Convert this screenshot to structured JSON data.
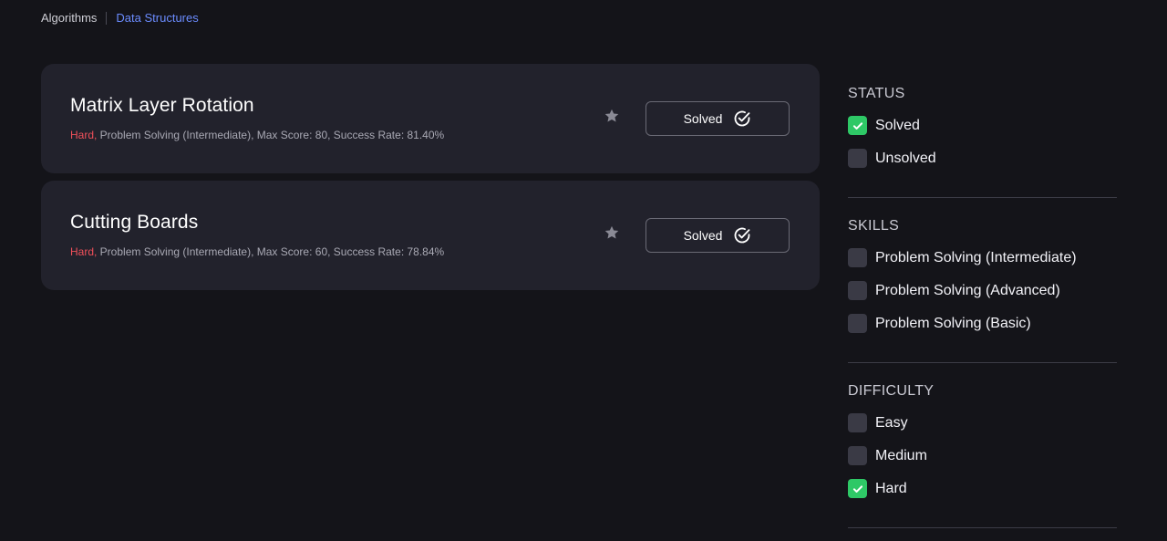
{
  "breadcrumb": {
    "items": [
      "Algorithms",
      "Data Structures"
    ]
  },
  "challenges": [
    {
      "title": "Matrix Layer Rotation",
      "difficulty": "Hard,",
      "details": " Problem Solving (Intermediate), Max Score: 80, Success Rate: 81.40%",
      "button_label": "Solved"
    },
    {
      "title": "Cutting Boards",
      "difficulty": "Hard,",
      "details": " Problem Solving (Intermediate), Max Score: 60, Success Rate: 78.84%",
      "button_label": "Solved"
    }
  ],
  "filters": {
    "status": {
      "title": "STATUS",
      "options": [
        {
          "label": "Solved",
          "checked": true
        },
        {
          "label": "Unsolved",
          "checked": false
        }
      ]
    },
    "skills": {
      "title": "SKILLS",
      "options": [
        {
          "label": "Problem Solving (Intermediate)",
          "checked": false
        },
        {
          "label": "Problem Solving (Advanced)",
          "checked": false
        },
        {
          "label": "Problem Solving (Basic)",
          "checked": false
        }
      ]
    },
    "difficulty": {
      "title": "DIFFICULTY",
      "options": [
        {
          "label": "Easy",
          "checked": false
        },
        {
          "label": "Medium",
          "checked": false
        },
        {
          "label": "Hard",
          "checked": true
        }
      ]
    }
  },
  "colors": {
    "background": "#141419",
    "card": "#22222c",
    "accent_link": "#6b8cff",
    "difficulty_hard": "#f0505a",
    "checkbox_checked": "#2ec866"
  },
  "icons": {
    "star": "star-icon",
    "solved": "check-circle-icon",
    "checkbox": "checkmark-icon"
  }
}
